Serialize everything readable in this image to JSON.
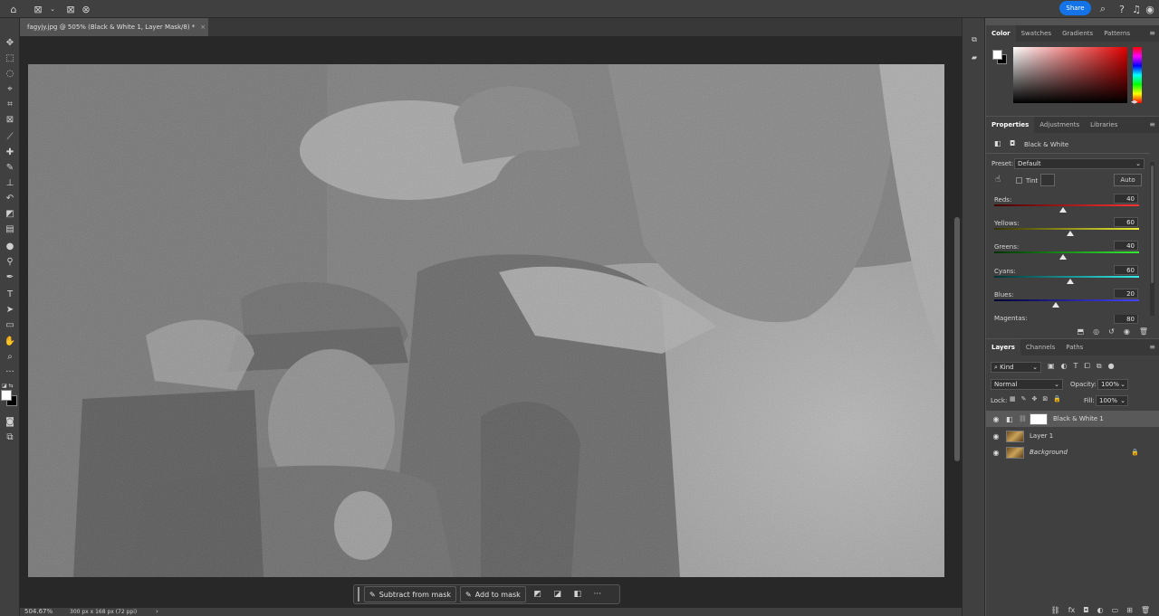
{
  "topbar": {
    "share_label": "Share"
  },
  "document": {
    "tab_title": "fagyjy.jpg @ 505% (Black & White 1, Layer Mask/8) *",
    "zoom": "504.67%",
    "doc_info": "300 px x 168 px (72 ppi)"
  },
  "context_bar": {
    "subtract_label": "Subtract from mask",
    "add_label": "Add to mask",
    "more_label": "···"
  },
  "color_panel": {
    "tabs": [
      "Color",
      "Swatches",
      "Gradients",
      "Patterns"
    ]
  },
  "properties_panel": {
    "tabs": [
      "Properties",
      "Adjustments",
      "Libraries"
    ],
    "adjustment_name": "Black & White",
    "preset_label": "Preset:",
    "preset_value": "Default",
    "tint_label": "Tint",
    "auto_label": "Auto",
    "sliders": [
      {
        "label": "Reds:",
        "value": "40",
        "pos": 0.475
      },
      {
        "label": "Yellows:",
        "value": "60",
        "pos": 0.525
      },
      {
        "label": "Greens:",
        "value": "40",
        "pos": 0.475
      },
      {
        "label": "Cyans:",
        "value": "60",
        "pos": 0.525
      },
      {
        "label": "Blues:",
        "value": "20",
        "pos": 0.425
      },
      {
        "label": "Magentas:",
        "value": "80"
      }
    ]
  },
  "layers_panel": {
    "tabs": [
      "Layers",
      "Channels",
      "Paths"
    ],
    "filter_kind": "Kind",
    "blend_mode": "Normal",
    "opacity_label": "Opacity:",
    "opacity_value": "100%",
    "lock_label": "Lock:",
    "fill_label": "Fill:",
    "fill_value": "100%",
    "layers": [
      {
        "name": "Black & White 1"
      },
      {
        "name": "Layer 1"
      },
      {
        "name": "Background"
      }
    ]
  }
}
